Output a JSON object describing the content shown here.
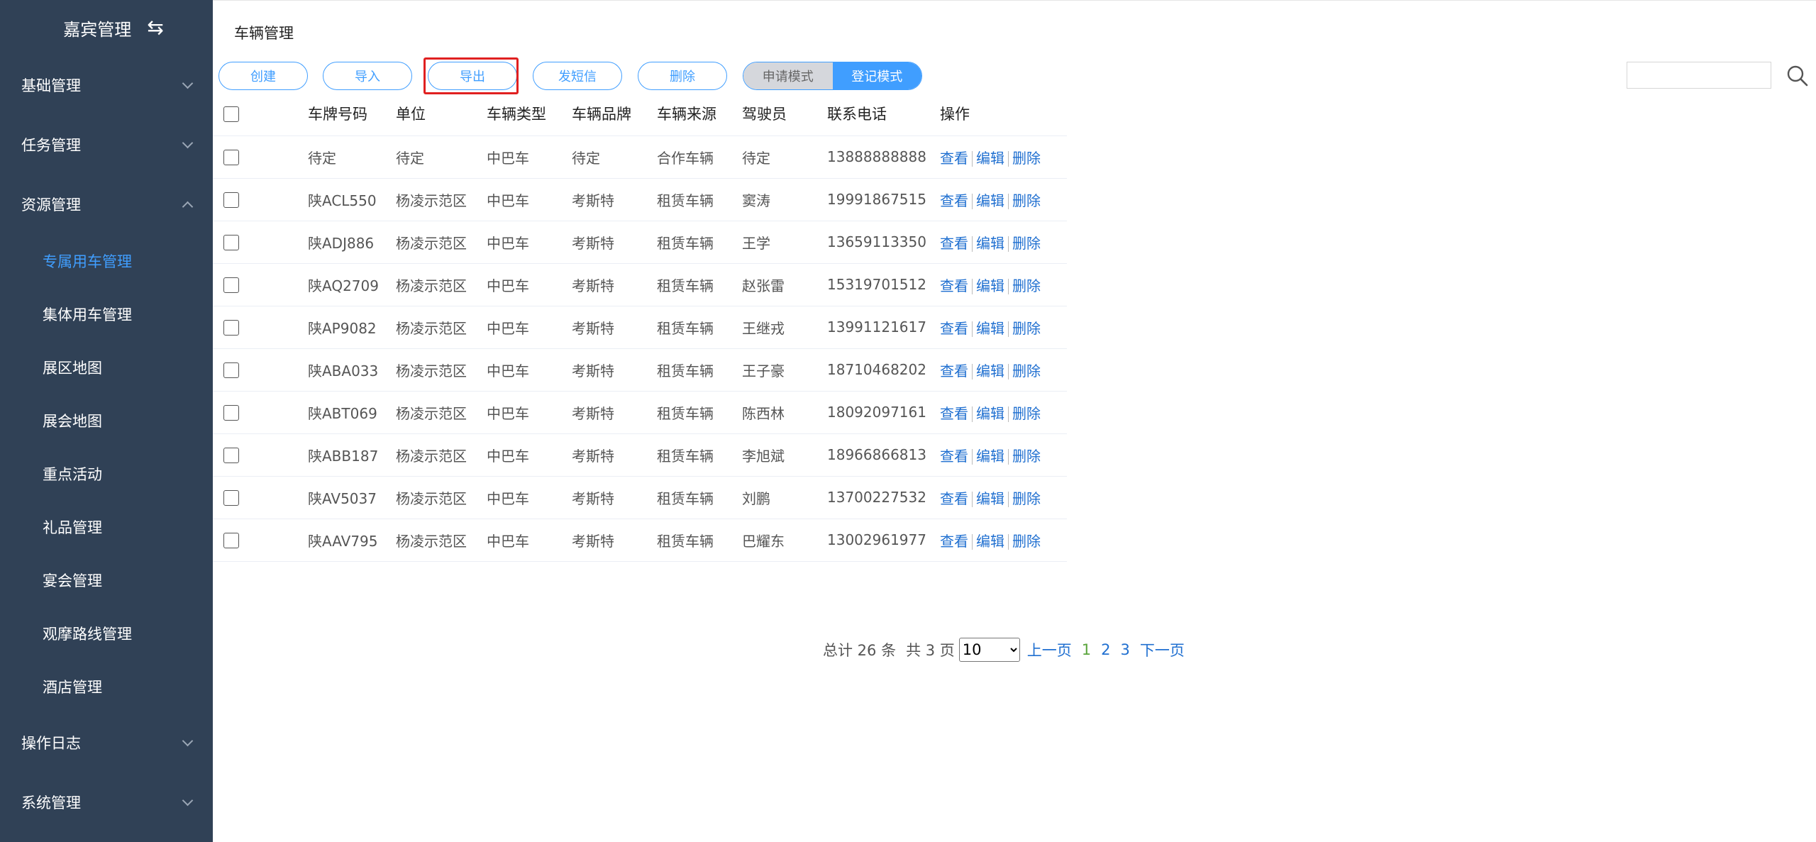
{
  "sidebar": {
    "brand": "嘉宾管理",
    "toggle_icon": "swap-icon",
    "groups": [
      {
        "label": "基础管理",
        "expanded": false
      },
      {
        "label": "任务管理",
        "expanded": false
      },
      {
        "label": "资源管理",
        "expanded": true
      },
      {
        "label": "操作日志",
        "expanded": false
      },
      {
        "label": "系统管理",
        "expanded": false
      }
    ],
    "resource_items": [
      {
        "label": "专属用车管理",
        "active": true
      },
      {
        "label": "集体用车管理"
      },
      {
        "label": "展区地图"
      },
      {
        "label": "展会地图"
      },
      {
        "label": "重点活动"
      },
      {
        "label": "礼品管理"
      },
      {
        "label": "宴会管理"
      },
      {
        "label": "观摩路线管理"
      },
      {
        "label": "酒店管理"
      }
    ]
  },
  "page": {
    "title": "车辆管理"
  },
  "toolbar": {
    "create": "创建",
    "import": "导入",
    "export": "导出",
    "sms": "发短信",
    "delete": "删除",
    "mode_apply": "申请模式",
    "mode_register": "登记模式",
    "search_placeholder": ""
  },
  "table": {
    "headers": [
      "车牌号码",
      "单位",
      "车辆类型",
      "车辆品牌",
      "车辆来源",
      "驾驶员",
      "联系电话",
      "操作"
    ],
    "actions": {
      "view": "查看",
      "edit": "编辑",
      "delete": "删除"
    },
    "rows": [
      [
        "待定",
        "待定",
        "中巴车",
        "待定",
        "合作车辆",
        "待定",
        "13888888888"
      ],
      [
        "陕ACL550",
        "杨凌示范区",
        "中巴车",
        "考斯特",
        "租赁车辆",
        "窦涛",
        "19991867515"
      ],
      [
        "陕ADJ886",
        "杨凌示范区",
        "中巴车",
        "考斯特",
        "租赁车辆",
        "王学",
        "13659113350"
      ],
      [
        "陕AQ2709",
        "杨凌示范区",
        "中巴车",
        "考斯特",
        "租赁车辆",
        "赵张雷",
        "15319701512"
      ],
      [
        "陕AP9082",
        "杨凌示范区",
        "中巴车",
        "考斯特",
        "租赁车辆",
        "王继戎",
        "13991121617"
      ],
      [
        "陕ABA033",
        "杨凌示范区",
        "中巴车",
        "考斯特",
        "租赁车辆",
        "王子豪",
        "18710468202"
      ],
      [
        "陕ABT069",
        "杨凌示范区",
        "中巴车",
        "考斯特",
        "租赁车辆",
        "陈西林",
        "18092097161"
      ],
      [
        "陕ABB187",
        "杨凌示范区",
        "中巴车",
        "考斯特",
        "租赁车辆",
        "李旭斌",
        "18966866813"
      ],
      [
        "陕AV5037",
        "杨凌示范区",
        "中巴车",
        "考斯特",
        "租赁车辆",
        "刘鹏",
        "13700227532"
      ],
      [
        "陕AAV795",
        "杨凌示范区",
        "中巴车",
        "考斯特",
        "租赁车辆",
        "巴耀东",
        "13002961977"
      ]
    ]
  },
  "pagination": {
    "total": "总计 26 条",
    "pages": "共 3 页",
    "page_size": "10",
    "page_size_options": [
      "10"
    ],
    "prev": "上一页",
    "page_numbers": [
      "1",
      "2",
      "3"
    ],
    "current": "1",
    "next": "下一页"
  },
  "colors": {
    "sidebar_bg": "#304156",
    "accent": "#409eff",
    "active_page": "#5aa53c",
    "highlight": "#e02020"
  }
}
